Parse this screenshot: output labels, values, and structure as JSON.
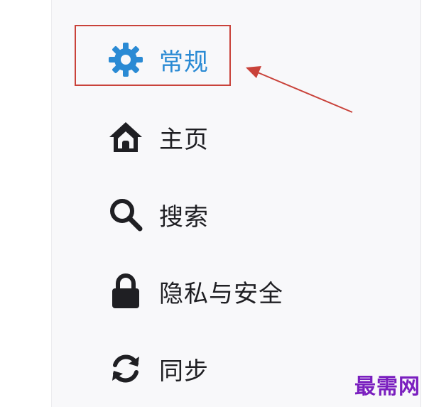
{
  "sidebar": {
    "items": [
      {
        "id": "general",
        "label": "常规",
        "icon": "gear-icon",
        "selected": true
      },
      {
        "id": "home",
        "label": "主页",
        "icon": "home-icon",
        "selected": false
      },
      {
        "id": "search",
        "label": "搜索",
        "icon": "search-icon",
        "selected": false
      },
      {
        "id": "privacy",
        "label": "隐私与安全",
        "icon": "lock-icon",
        "selected": false
      },
      {
        "id": "sync",
        "label": "同步",
        "icon": "sync-icon",
        "selected": false
      }
    ]
  },
  "annotation": {
    "box_color": "#c9423a",
    "arrow_color": "#c9423a"
  },
  "colors": {
    "accent": "#2a8ad4",
    "text": "#1f1f23",
    "background": "#f8f8fa"
  },
  "watermark": {
    "text": "最需网",
    "color": "#7a1fbf"
  }
}
